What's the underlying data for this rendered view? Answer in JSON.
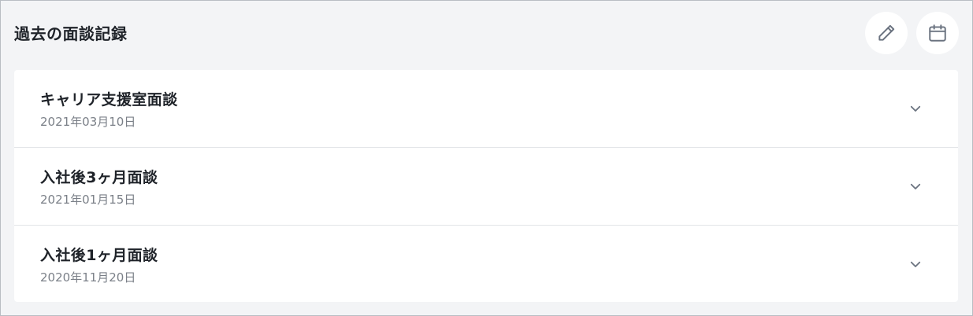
{
  "panel": {
    "title": "過去の面談記録",
    "actions": {
      "edit_icon": "pencil-icon",
      "calendar_icon": "calendar-icon"
    }
  },
  "records": [
    {
      "title": "キャリア支援室面談",
      "date": "2021年03月10日"
    },
    {
      "title": "入社後3ヶ月面談",
      "date": "2021年01月15日"
    },
    {
      "title": "入社後1ヶ月面談",
      "date": "2020年11月20日"
    }
  ],
  "colors": {
    "panel_background": "#f3f4f6",
    "card_background": "#ffffff",
    "title_text": "#1f2329",
    "date_text": "#7b8088",
    "icon": "#6b7380"
  }
}
